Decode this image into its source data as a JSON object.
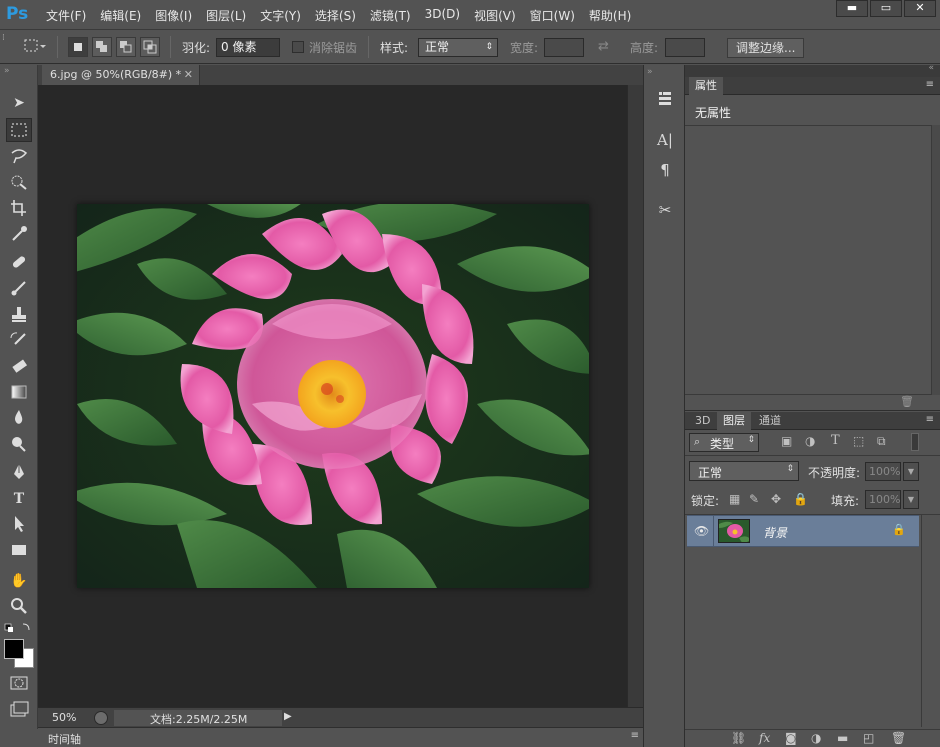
{
  "app": {
    "logo": "Ps",
    "menu": [
      "文件(F)",
      "编辑(E)",
      "图像(I)",
      "图层(L)",
      "文字(Y)",
      "选择(S)",
      "滤镜(T)",
      "3D(D)",
      "视图(V)",
      "窗口(W)",
      "帮助(H)"
    ],
    "window_controls": {
      "minimize": "▬",
      "maximize": "▭",
      "close": "✕"
    }
  },
  "options": {
    "feather_label": "羽化:",
    "feather_value": "0 像素",
    "antialias_label": "消除锯齿",
    "style_label": "样式:",
    "style_value": "正常",
    "width_label": "宽度:",
    "height_label": "高度:",
    "refine_edge_button": "调整边缘..."
  },
  "document": {
    "tab_title": "6.jpg @ 50%(RGB/8#) *",
    "zoom": "50%",
    "doc_info": "文档:2.25M/2.25M",
    "timeline_label": "时间轴"
  },
  "properties_panel": {
    "tab": "属性",
    "content": "无属性"
  },
  "layers_panel": {
    "tabs": [
      "3D",
      "图层",
      "通道"
    ],
    "active_tab": "图层",
    "filter_label": "类型",
    "blend_mode": "正常",
    "opacity_label": "不透明度:",
    "opacity_value": "100%",
    "lock_label": "锁定:",
    "fill_label": "填充:",
    "fill_value": "100%",
    "layers": [
      {
        "name": "背景",
        "visible": true,
        "locked": true
      }
    ]
  },
  "colors": {
    "accent_ps": "#2d9be0",
    "layer_selected": "#6a7e99"
  }
}
